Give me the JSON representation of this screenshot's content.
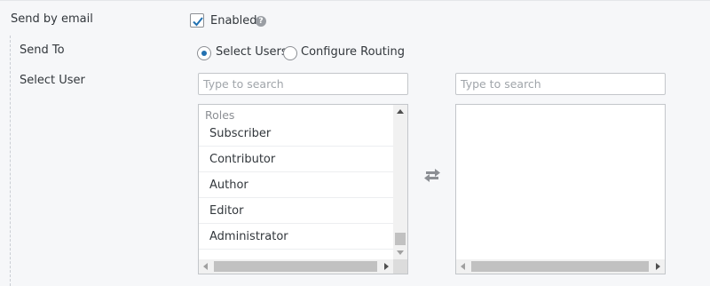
{
  "send_by_email": {
    "label": "Send by email",
    "enabled_label": "Enabled",
    "enabled_checked": true,
    "help_icon": "question-circle-icon"
  },
  "send_to": {
    "label": "Send To",
    "options": [
      {
        "label": "Select Users",
        "selected": true
      },
      {
        "label": "Configure Routing",
        "selected": false
      }
    ]
  },
  "select_user": {
    "label": "Select User",
    "available": {
      "search_placeholder": "Type to search",
      "group_label": "Roles",
      "items": [
        "Subscriber",
        "Contributor",
        "Author",
        "Editor",
        "Administrator"
      ]
    },
    "selected": {
      "search_placeholder": "Type to search",
      "items": []
    },
    "transfer_icon": "exchange-arrows-icon"
  },
  "colors": {
    "accent": "#2271b1",
    "background": "#f6f7f9",
    "border": "#c3c6ca"
  }
}
